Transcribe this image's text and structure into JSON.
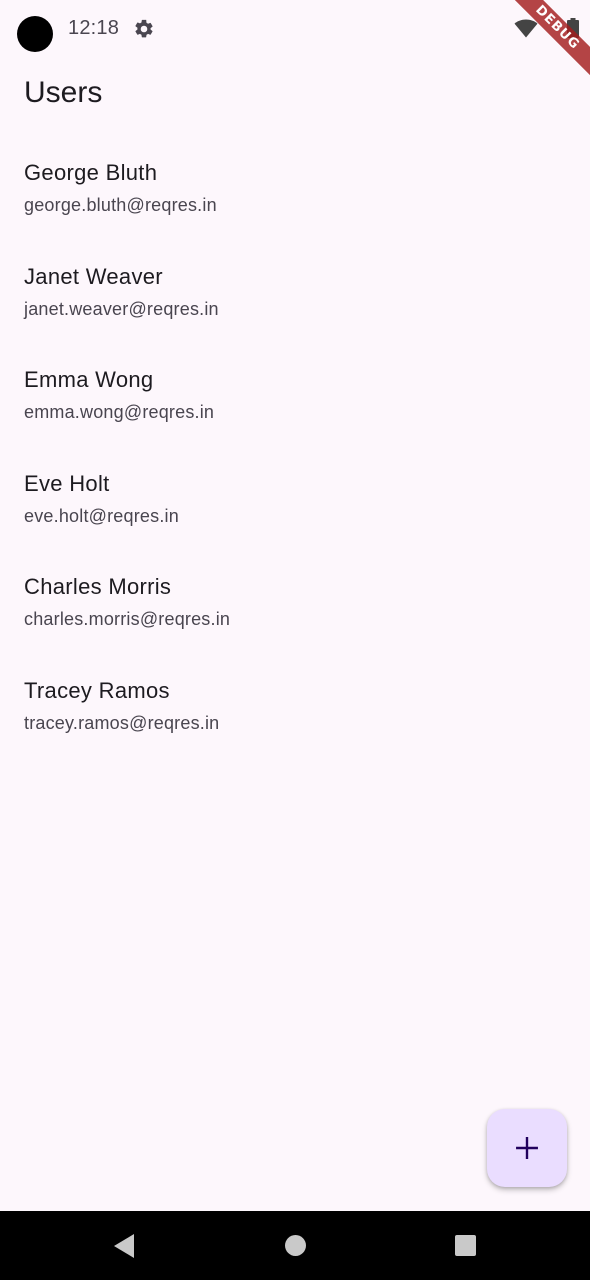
{
  "status_bar": {
    "time": "12:18",
    "icons": [
      "settings-icon",
      "wifi-icon",
      "battery-icon"
    ]
  },
  "debug_banner": "DEBUG",
  "app_bar": {
    "title": "Users"
  },
  "users": [
    {
      "name": "George Bluth",
      "email": "george.bluth@reqres.in"
    },
    {
      "name": "Janet Weaver",
      "email": "janet.weaver@reqres.in"
    },
    {
      "name": "Emma Wong",
      "email": "emma.wong@reqres.in"
    },
    {
      "name": "Eve Holt",
      "email": "eve.holt@reqres.in"
    },
    {
      "name": "Charles Morris",
      "email": "charles.morris@reqres.in"
    },
    {
      "name": "Tracey Ramos",
      "email": "tracey.ramos@reqres.in"
    }
  ],
  "fab": {
    "icon": "add-icon",
    "color": "#eaddff",
    "icon_color": "#21005d"
  },
  "navigation_bar": {
    "icons": [
      "back-icon",
      "home-icon",
      "recents-icon"
    ]
  },
  "colors": {
    "background": "#fdf7fc",
    "text_primary": "#1d1b20",
    "text_secondary": "#49454f"
  }
}
